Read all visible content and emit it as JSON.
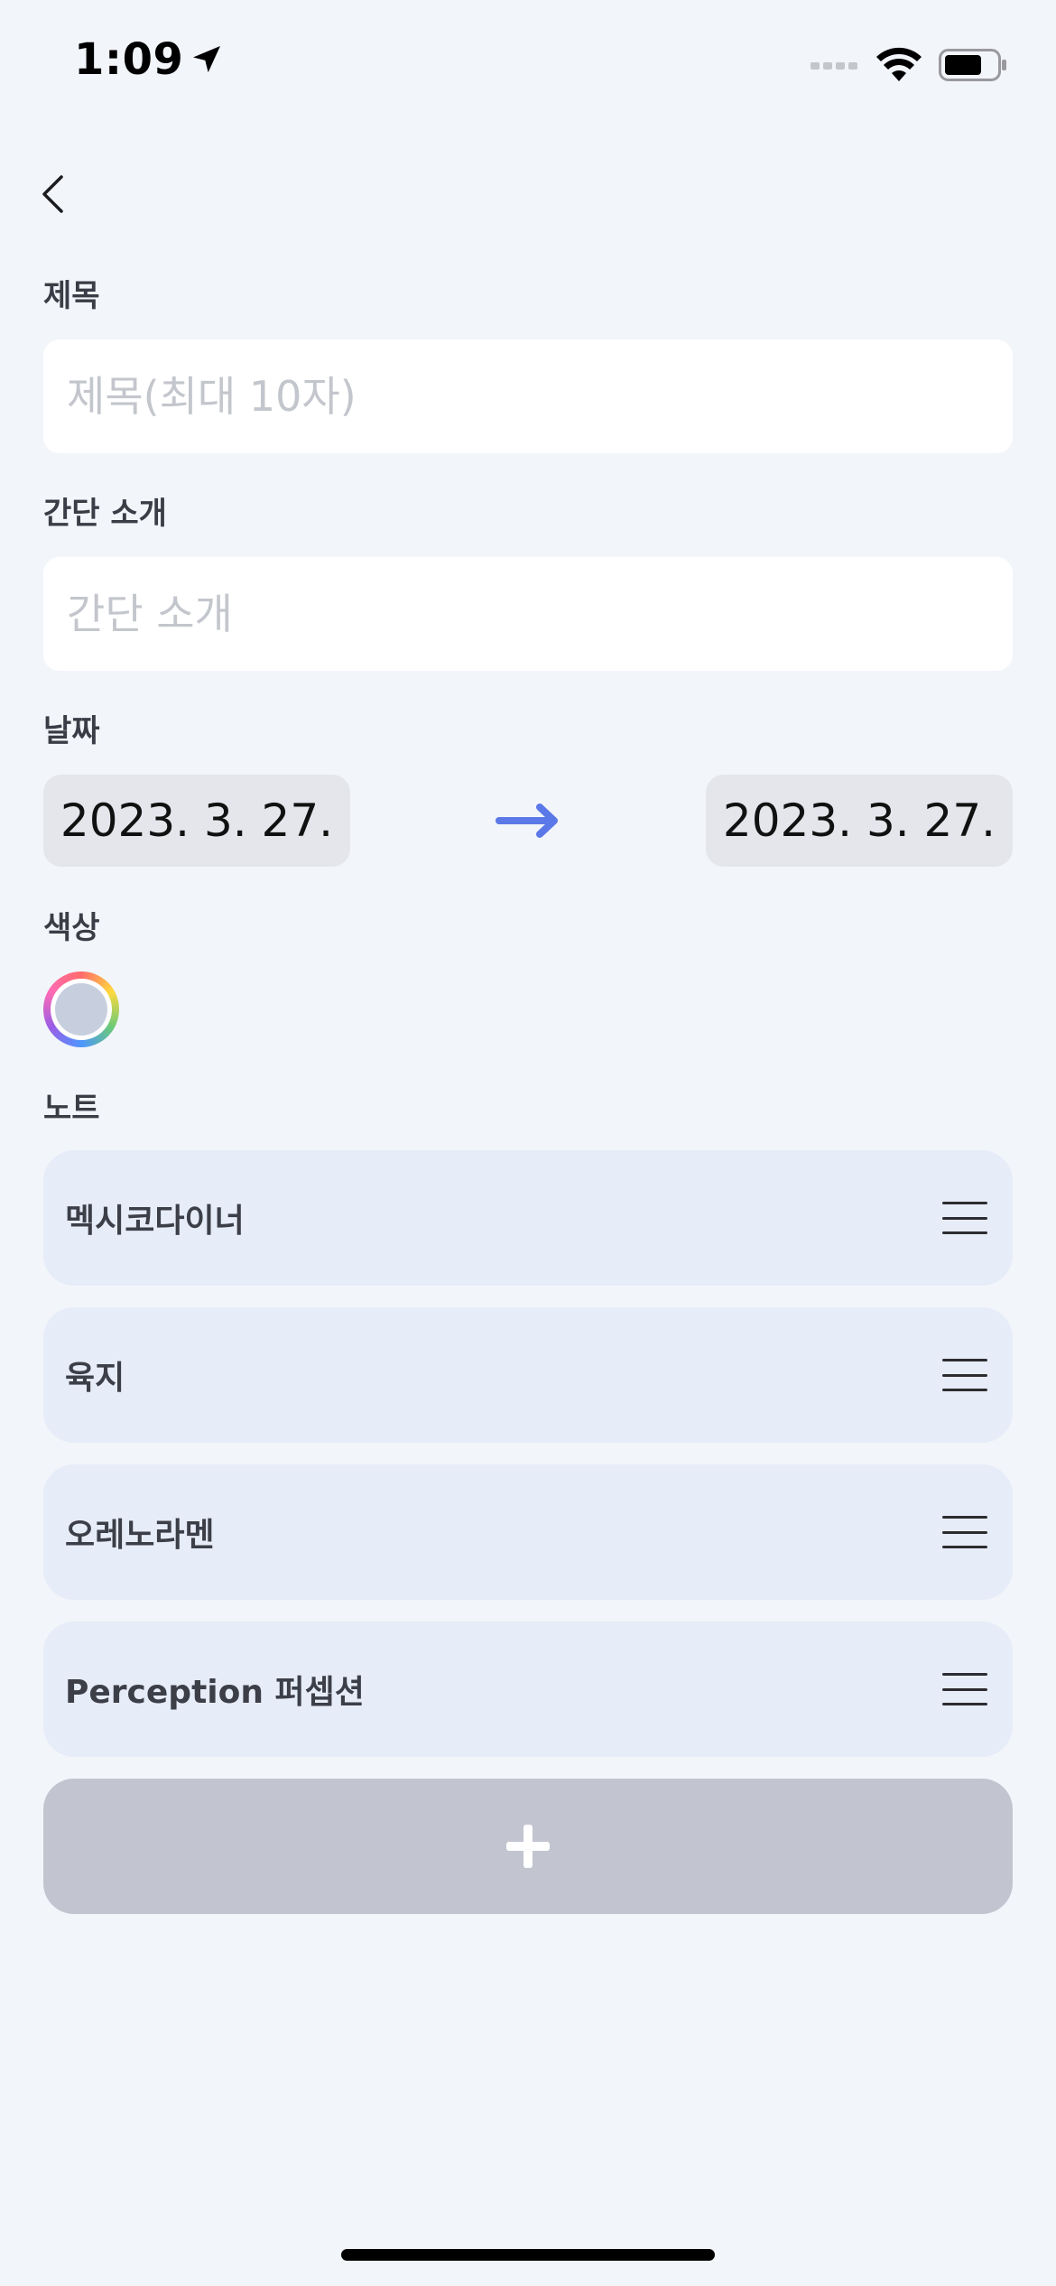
{
  "status_bar": {
    "time": "1:09"
  },
  "form": {
    "title_label": "제목",
    "title_placeholder": "제목(최대 10자)",
    "title_value": "",
    "intro_label": "간단 소개",
    "intro_placeholder": "간단 소개",
    "intro_value": "",
    "date_label": "날짜",
    "start_date": "2023. 3. 27.",
    "end_date": "2023. 3. 27.",
    "color_label": "색상",
    "selected_color": "#c7cfdf",
    "notes_label": "노트",
    "notes": [
      {
        "label": "멕시코다이너"
      },
      {
        "label": "육지"
      },
      {
        "label": "오레노라멘"
      },
      {
        "label": "Perception 퍼셉션"
      }
    ],
    "add_note_icon": "plus-icon"
  },
  "colors": {
    "background": "#f2f5fa",
    "note_row": "#e6ecf8",
    "add_button": "#c2c5d0",
    "date_button": "#e4e6ec",
    "arrow_accent": "#5b78e8"
  }
}
